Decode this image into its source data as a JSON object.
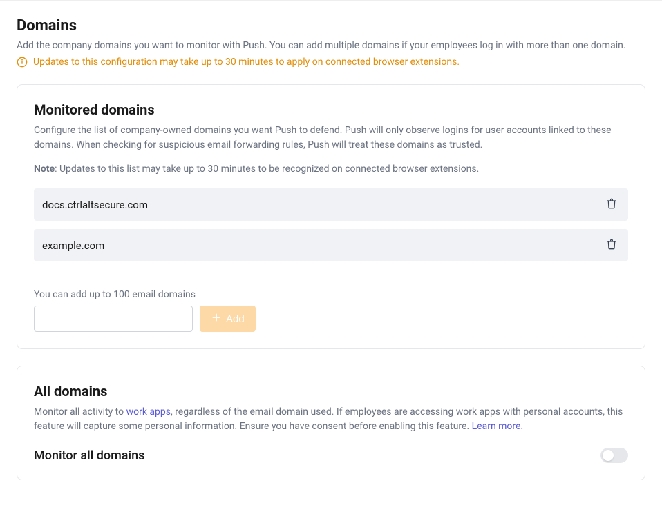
{
  "header": {
    "title": "Domains",
    "subtitle": "Add the company domains you want to monitor with Push. You can add multiple domains if your employees log in with more than one domain.",
    "warning": "Updates to this configuration may take up to 30 minutes to apply on connected browser extensions."
  },
  "monitored": {
    "title": "Monitored domains",
    "description": "Configure the list of company-owned domains you want Push to defend. Push will only observe logins for user accounts linked to these domains. When checking for suspicious email forwarding rules, Push will treat these domains as trusted.",
    "note_label": "Note",
    "note_text": ": Updates to this list may take up to 30 minutes to be recognized on connected browser extensions.",
    "domains": [
      {
        "name": "docs.ctrlaltsecure.com"
      },
      {
        "name": "example.com"
      }
    ],
    "add_hint": "You can add up to 100 email domains",
    "add_input_value": "",
    "add_button_label": "Add"
  },
  "all": {
    "title": "All domains",
    "desc_prefix": "Monitor all activity to ",
    "work_apps_label": "work apps",
    "desc_middle": ", regardless of the email domain used. If employees are accessing work apps with personal accounts, this feature will capture some personal information. Ensure you have consent before enabling this feature. ",
    "learn_more_label": "Learn more.",
    "toggle_label": "Monitor all domains",
    "toggle_state": "off"
  }
}
